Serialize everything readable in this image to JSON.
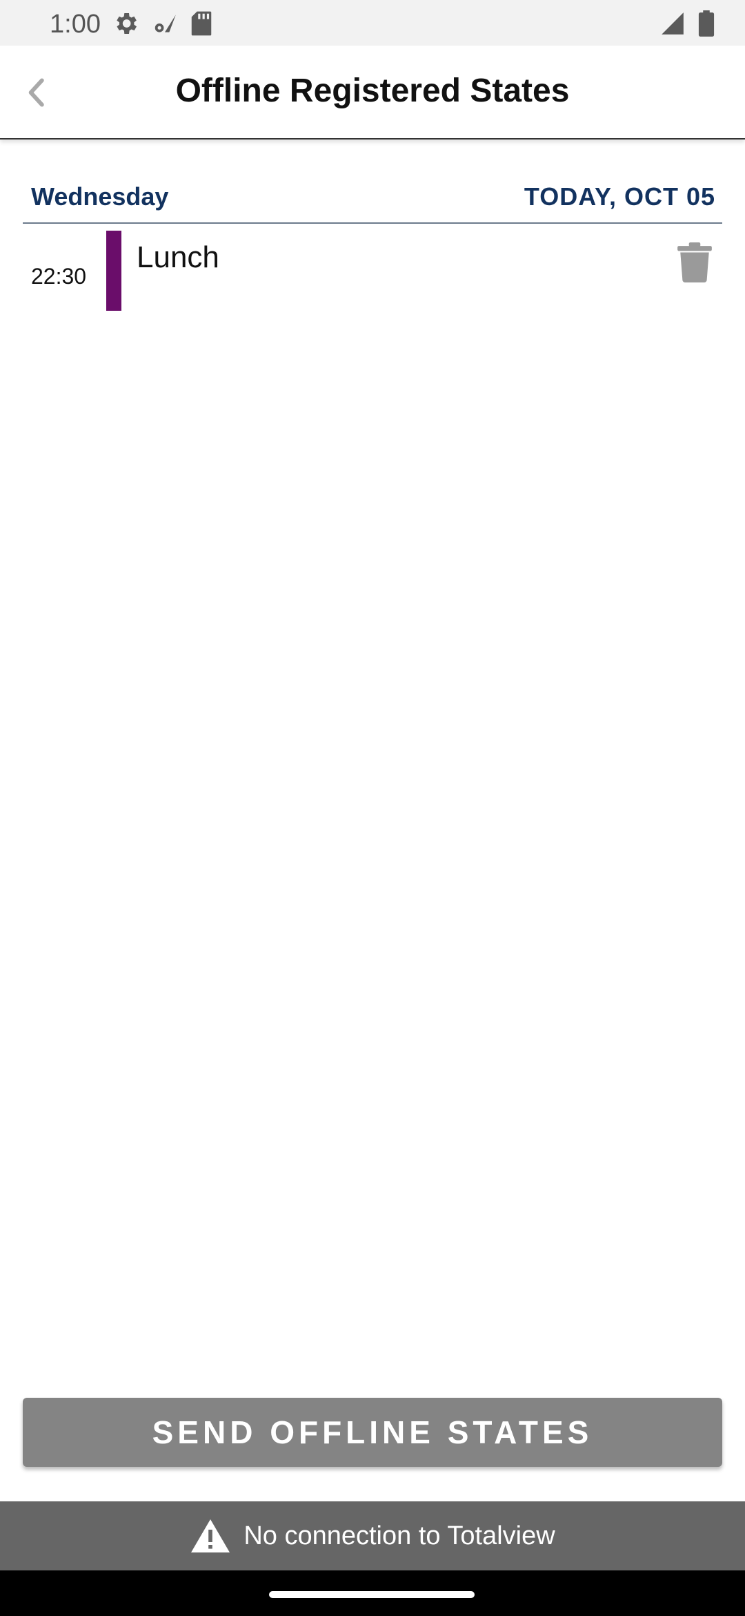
{
  "status_bar": {
    "time": "1:00",
    "left_icons": [
      "settings-gear-icon",
      "wifi-settings-icon",
      "sd-card-icon"
    ],
    "right_icons": [
      "cell-signal-icon",
      "battery-icon"
    ]
  },
  "app_bar": {
    "title": "Offline Registered States",
    "back_icon": "chevron-left-icon"
  },
  "day_header": {
    "day": "Wednesday",
    "date": "TODAY, OCT 05"
  },
  "entries": [
    {
      "time": "22:30",
      "label": "Lunch",
      "color": "#6a0d6a",
      "delete_icon": "trash-icon"
    }
  ],
  "send_button": {
    "label": "SEND OFFLINE STATES"
  },
  "connection_banner": {
    "icon": "warning-icon",
    "text": "No connection to Totalview"
  },
  "colors": {
    "accent_text": "#12325f",
    "button_bg": "#848484",
    "banner_bg": "#666666"
  }
}
